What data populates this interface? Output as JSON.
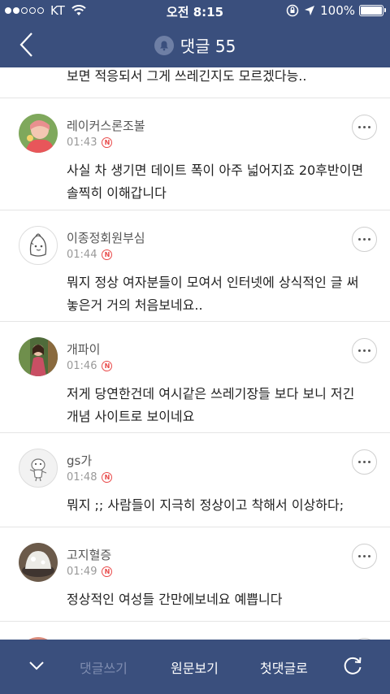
{
  "status_bar": {
    "carrier": "KT",
    "time": "오전 8:15",
    "battery": "100%"
  },
  "nav": {
    "title": "댓글 55"
  },
  "partial_comment_text": "보면 적응되서 그게 쓰레긴지도 모르겠다능..",
  "comments": [
    {
      "username": "레이커스론조볼",
      "time": "01:43",
      "badge": "N",
      "text": "사실 차 생기면 데이트 폭이 아주 넓어지죠 20후반이면 솔찍히 이해갑니다"
    },
    {
      "username": "이종정회원부심",
      "time": "01:44",
      "badge": "N",
      "text": "뭐지 정상 여자분들이 모여서 인터넷에 상식적인 글 써놓은거 거의 처음보네요.."
    },
    {
      "username": "개파이",
      "time": "01:46",
      "badge": "N",
      "text": "저게 당연한건데 여시같은 쓰레기장들 보다 보니 저긴 개념 사이트로 보이네요"
    },
    {
      "username": "gs가",
      "time": "01:48",
      "badge": "N",
      "text": "뭐지 ;; 사람들이 지극히 정상이고 착해서 이상하다;"
    },
    {
      "username": "고지혈증",
      "time": "01:49",
      "badge": "N",
      "text": "정상적인 여성들 간만에보네요 예쁩니다"
    }
  ],
  "bottom_bar": {
    "write": "댓글쓰기",
    "original": "원문보기",
    "first": "첫댓글로"
  },
  "colors": {
    "brand_bar": "#3a4f7d",
    "new_badge": "#e94a4a",
    "disabled_text": "#7f8db0"
  }
}
